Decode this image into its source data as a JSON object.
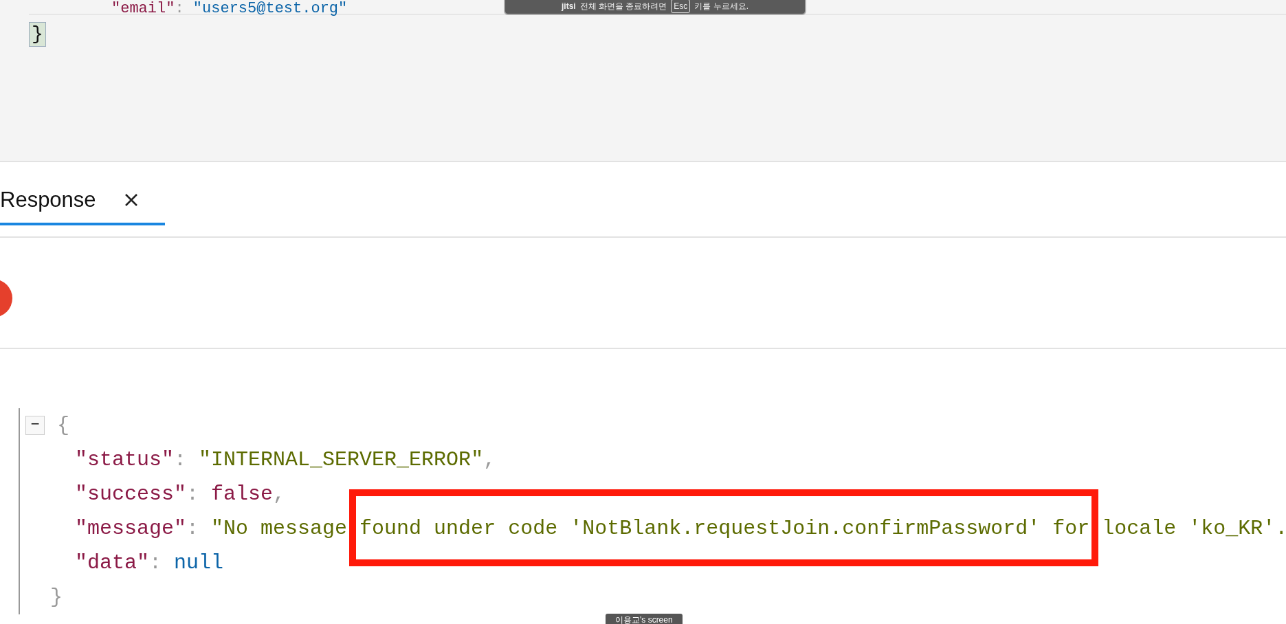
{
  "editor": {
    "top_line": {
      "key": "\"email\"",
      "sep": ":",
      "value": "\"users5@test.org\""
    },
    "closing": "}"
  },
  "toast": {
    "brand": "jitsi",
    "text_before": "전체 화면을 종료하려면",
    "key": "Esc",
    "text_after": "키를 누르세요."
  },
  "tabs": [
    {
      "label": "Response",
      "selected": true
    }
  ],
  "response": {
    "collapse": "−",
    "open": "{",
    "close": "}",
    "lines": [
      {
        "key": "\"status\"",
        "sep": ":",
        "value": "\"INTERNAL_SERVER_ERROR\"",
        "kind": "string",
        "comma": ","
      },
      {
        "key": "\"success\"",
        "sep": ":",
        "value": "false",
        "kind": "literal",
        "comma": ","
      },
      {
        "key": "\"message\"",
        "sep": ":",
        "value": "\"No message found under code 'NotBlank.requestJoin.confirmPassword' for locale 'ko_KR'.",
        "kind": "string"
      },
      {
        "key": "\"data\"",
        "sep": ":",
        "value": "null",
        "kind": "null"
      }
    ]
  },
  "screen_label": "이용교's screen"
}
